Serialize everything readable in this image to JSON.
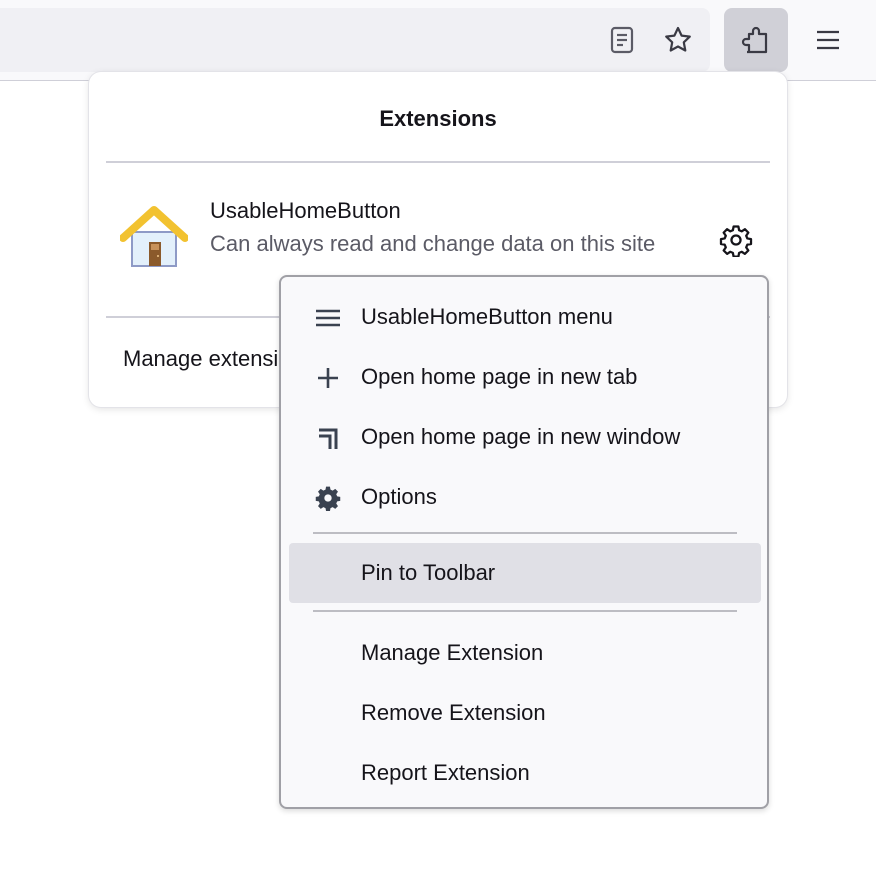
{
  "toolbar": {
    "reader_view_icon": "reader-view-icon",
    "bookmark_icon": "star-icon",
    "extensions_icon": "puzzle-piece-icon",
    "menu_icon": "hamburger-menu-icon"
  },
  "panel": {
    "title": "Extensions",
    "extension": {
      "name": "UsableHomeButton",
      "description": "Can always read and change data on this site",
      "icon": "house-icon",
      "settings_icon": "gear-icon"
    },
    "manage_label": "Manage extensions"
  },
  "context_menu": {
    "items": [
      {
        "label": "UsableHomeButton menu",
        "icon": "menu-lines-icon"
      },
      {
        "label": "Open home page in new tab",
        "icon": "plus-icon"
      },
      {
        "label": "Open home page in new window",
        "icon": "new-window-icon"
      },
      {
        "label": "Options",
        "icon": "gear-icon"
      },
      {
        "label": "Pin to Toolbar",
        "icon": null,
        "hovered": true
      },
      {
        "label": "Manage Extension",
        "icon": null
      },
      {
        "label": "Remove Extension",
        "icon": null
      },
      {
        "label": "Report Extension",
        "icon": null
      }
    ]
  },
  "colors": {
    "toolbar_bg": "#f9f9fb",
    "urlbar_bg": "#f0f0f4",
    "active_button_bg": "#d0d0d7",
    "menu_bg": "#f9f9fb",
    "menu_hover_bg": "#e0e0e6",
    "text_primary": "#15141a",
    "text_secondary": "#5b5b66",
    "icon_color": "#3a4250"
  }
}
